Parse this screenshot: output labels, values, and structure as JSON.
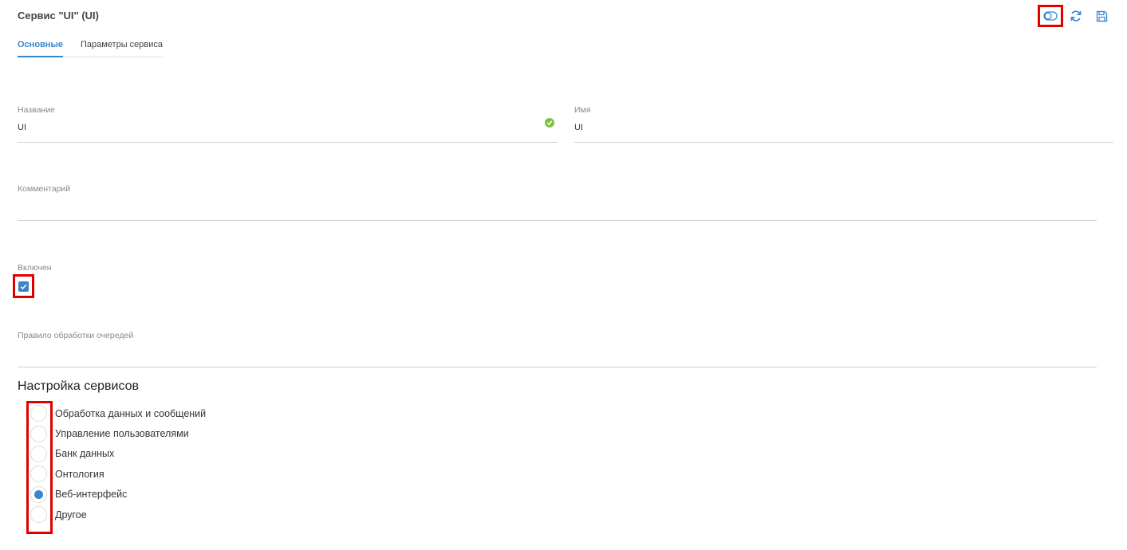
{
  "header": {
    "title": "Сервис \"UI\" (UI)"
  },
  "toolbar": {
    "buttons": [
      {
        "icon": "toggle-icon"
      },
      {
        "icon": "refresh-icon"
      },
      {
        "icon": "save-icon"
      }
    ]
  },
  "tabs": [
    {
      "label": "Основные",
      "active": true
    },
    {
      "label": "Параметры сервиса",
      "active": false
    }
  ],
  "fields": {
    "name": {
      "label": "Название",
      "value": "UI"
    },
    "id_name": {
      "label": "Имя",
      "value": "UI"
    },
    "comment": {
      "label": "Комментарий",
      "value": ""
    },
    "enabled": {
      "label": "Включен",
      "checked": true
    },
    "queue_rule": {
      "label": "Правило обработки очередей",
      "value": ""
    }
  },
  "services": {
    "title": "Настройка сервисов",
    "options": [
      {
        "label": "Обработка данных и сообщений",
        "selected": false
      },
      {
        "label": "Управление пользователями",
        "selected": false
      },
      {
        "label": "Банк данных",
        "selected": false
      },
      {
        "label": "Онтология",
        "selected": false
      },
      {
        "label": "Веб-интерфейс",
        "selected": true
      },
      {
        "label": "Другое",
        "selected": false
      }
    ]
  },
  "colors": {
    "accent": "#3a86c8",
    "success": "#7cc242",
    "highlight": "#e00000"
  }
}
